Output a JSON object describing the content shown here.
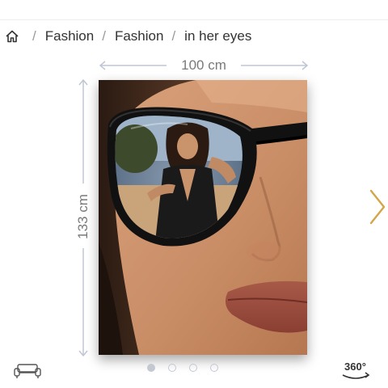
{
  "breadcrumb": {
    "home_icon": "home-icon",
    "items": [
      "Fashion",
      "Fashion",
      "in her eyes"
    ],
    "separator": "/"
  },
  "dimensions": {
    "width_label": "100 cm",
    "height_label": "133 cm"
  },
  "artwork": {
    "image": "woman-in-sunglasses-reflection-photo"
  },
  "navigation": {
    "next_icon": "chevron-right-icon",
    "next_color": "#d4a64a"
  },
  "footer": {
    "room_view_icon": "sofa-icon",
    "view360_label": "360°",
    "slide_count": 4,
    "active_slide": 1
  }
}
